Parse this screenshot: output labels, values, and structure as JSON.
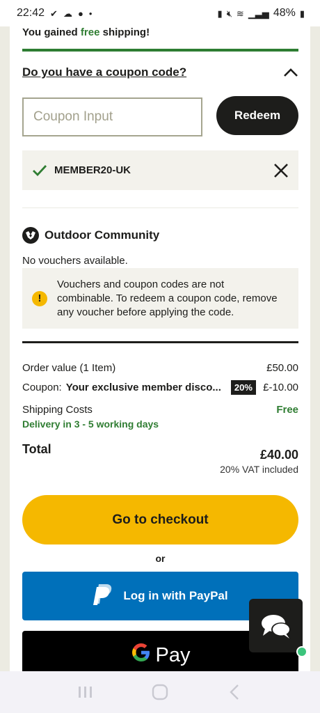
{
  "status_bar": {
    "time": "22:42",
    "battery": "48%"
  },
  "shipping": {
    "prefix": "You gained ",
    "highlight": "free",
    "suffix": " shipping!",
    "progress_fraction": 1.0
  },
  "coupon": {
    "question": "Do you have a coupon code?",
    "input_placeholder": "Coupon Input",
    "input_value": "",
    "redeem_label": "Redeem",
    "applied_code": "MEMBER20-UK"
  },
  "community": {
    "title": "Outdoor Community",
    "no_vouchers": "No vouchers available.",
    "notice_line1": "Vouchers and coupon codes are not",
    "notice_line2": "combinable. To redeem a coupon code, remove",
    "notice_line3": "any voucher before applying the code.",
    "notice_icon": "!"
  },
  "summary": {
    "order_label": "Order value (1 Item)",
    "order_value": "£50.00",
    "coupon_label": "Coupon:",
    "coupon_desc": "Your exclusive member disco...",
    "coupon_badge": "20%",
    "coupon_value": "£-10.00",
    "shipping_label": "Shipping Costs",
    "shipping_value": "Free",
    "delivery": "Delivery in 3 - 5 working days",
    "total_label": "Total",
    "total_value": "£40.00",
    "vat": "20% VAT included"
  },
  "actions": {
    "checkout_label": "Go to checkout",
    "or_label": "or",
    "paypal_label": "Log in with PayPal",
    "gpay_g": "G",
    "gpay_label": "Pay"
  },
  "colors": {
    "brand_yellow": "#f5b800",
    "success_green": "#2f7d32",
    "paypal_blue": "#0070ba",
    "dark": "#1d1d1b"
  }
}
